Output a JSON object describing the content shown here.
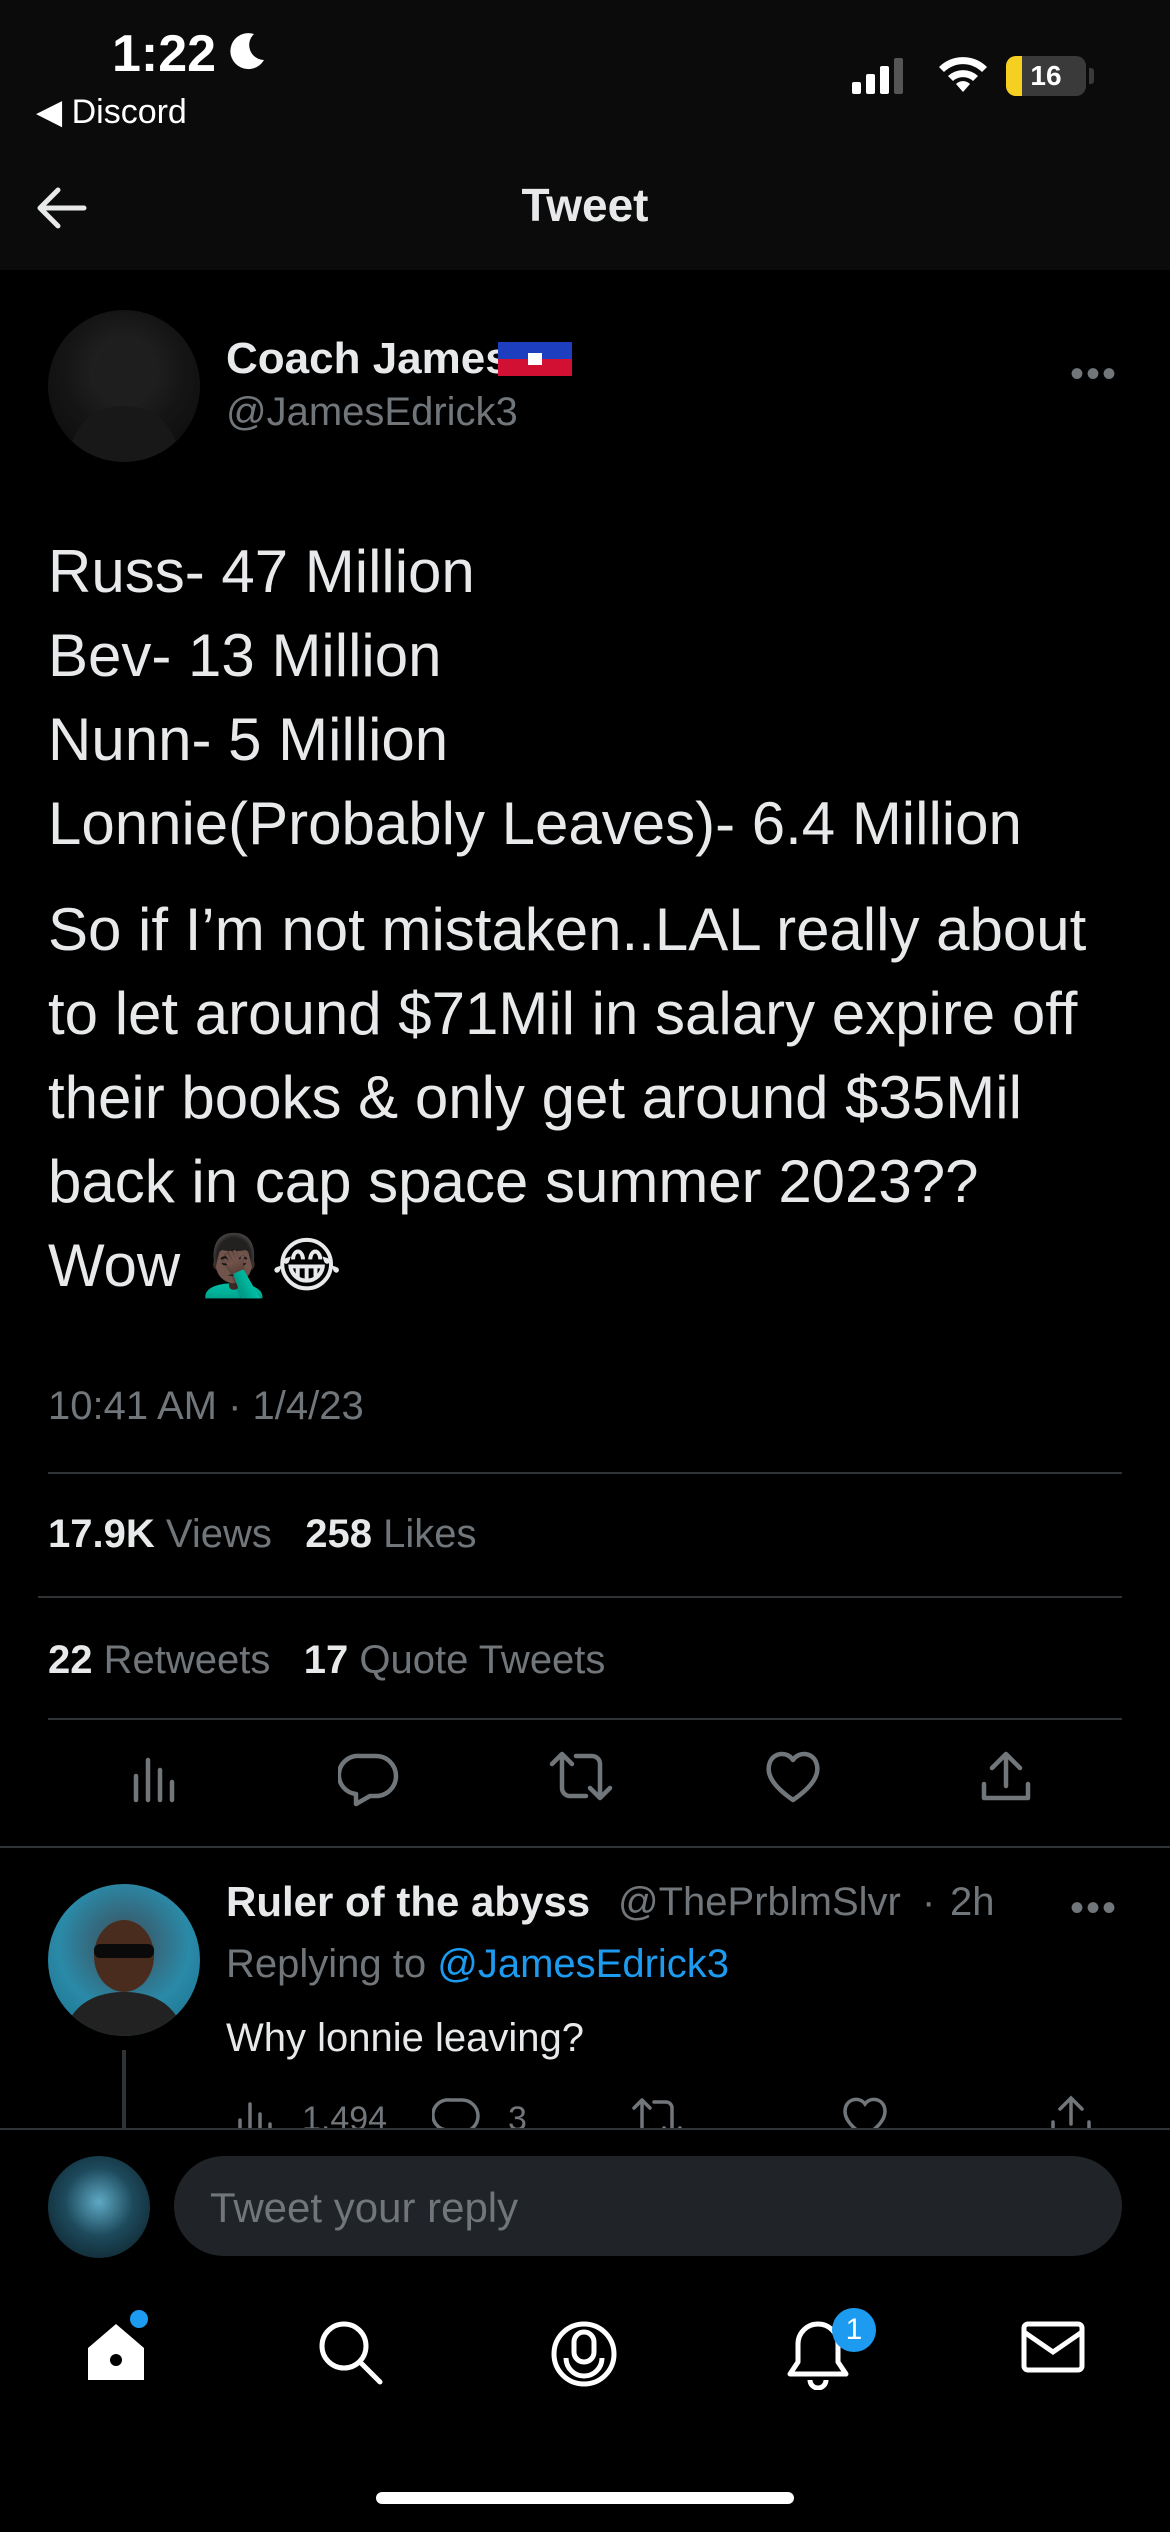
{
  "status_bar": {
    "time": "1:22",
    "back_app": "◀ Discord",
    "battery": "16"
  },
  "header": {
    "title": "Tweet"
  },
  "tweet": {
    "author_name": "Coach James",
    "author_handle": "@JamesEdrick3",
    "lines": [
      "Russ- 47 Million",
      "Bev- 13 Million",
      "Nunn- 5 Million",
      "Lonnie(Probably Leaves)- 6.4 Million"
    ],
    "paragraph": "So if I’m not mistaken..LAL really about to let around $71Mil in salary expire off their books & only get around $35Mil back in cap space summer 2023?? Wow 🤦🏿‍♂️😂",
    "timestamp": "10:41 AM · 1/4/23",
    "views_count": "17.9K",
    "views_label": "Views",
    "likes_count": "258",
    "likes_label": "Likes",
    "retweets_count": "22",
    "retweets_label": "Retweets",
    "quotes_count": "17",
    "quotes_label": "Quote Tweets"
  },
  "reply": {
    "author_name": "Ruler of the abyss",
    "author_handle": "@ThePrblmSlvr",
    "time_ago": "2h",
    "replying_prefix": "Replying to",
    "replying_to": "@JamesEdrick3",
    "text": "Why lonnie leaving?",
    "views": "1,494",
    "replies": "3"
  },
  "composer": {
    "placeholder": "Tweet your reply"
  },
  "tab_bar": {
    "notifications_badge": "1"
  },
  "colors": {
    "accent": "#1d9bf0",
    "muted": "#71767b",
    "text": "#e7e9ea",
    "divider": "#2f3336"
  }
}
